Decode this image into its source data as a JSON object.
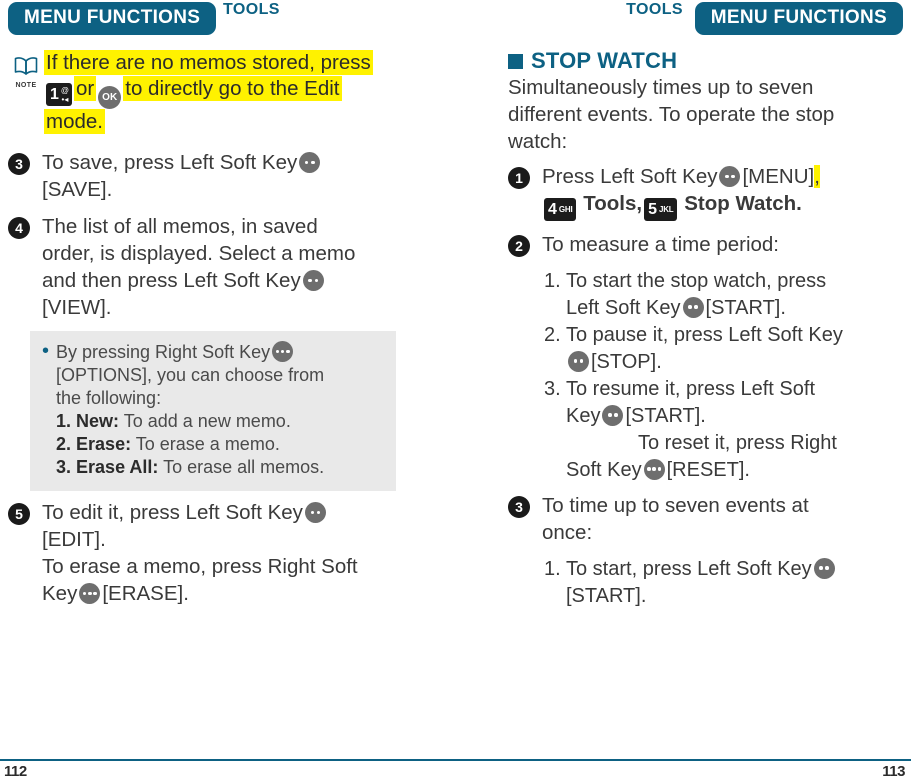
{
  "header": {
    "left_badge": "MENU FUNCTIONS",
    "left_sub": "TOOLS",
    "right_badge": "MENU FUNCTIONS",
    "right_sub": "TOOLS",
    "badge_color": "#0d6183"
  },
  "left_page": {
    "note": {
      "icon_label": "NOTE",
      "line1": "If there are no memos stored, press",
      "line2_or": "or",
      "line2_tail": "to directly go to the Edit",
      "line3": "mode.",
      "key1": {
        "digit": "1",
        "sym_top": "@",
        "sym_bottom": "•◂"
      },
      "ok_key": "OK",
      "highlight_color": "#fff200"
    },
    "steps": [
      {
        "num": "3",
        "line1_a": "To save, press Left Soft Key",
        "line2": "[SAVE]."
      },
      {
        "num": "4",
        "line1_a": "The list of all memos, in saved",
        "line2": "order, is displayed. Select a memo",
        "line3_a": "and then press Left Soft Key",
        "line4": "[VIEW]."
      }
    ],
    "options_box": {
      "bullet_line1": "By pressing Right Soft Key",
      "bullet_line2": "[OPTIONS], you can choose from",
      "bullet_line3": "the following:",
      "items": [
        {
          "num": "1.",
          "label": "New:",
          "desc": "To add a new memo."
        },
        {
          "num": "2.",
          "label": "Erase:",
          "desc": "To erase a memo."
        },
        {
          "num": "3.",
          "label": "Erase All:",
          "desc": "To erase all memos."
        }
      ]
    },
    "step5": {
      "num": "5",
      "line1_a": "To edit it, press Left Soft Key",
      "line2": "[EDIT].",
      "line3": "To erase a memo, press Right Soft",
      "line4_a": "Key",
      "line4_b": "[ERASE]."
    },
    "page_number": "112"
  },
  "right_page": {
    "section": {
      "title": "STOP WATCH",
      "intro_line1": "Simultaneously times up to seven",
      "intro_line2": "different events. To operate the stop",
      "intro_line3": "watch:"
    },
    "step1": {
      "num": "1",
      "line1_a": "Press Left Soft Key",
      "line1_b": "[MENU]",
      "line1_comma": ",",
      "line2_tools": "Tools,",
      "line2_stopwatch": "Stop Watch.",
      "key4": {
        "digit": "4",
        "letters": "GHI"
      },
      "key5": {
        "digit": "5",
        "letters": "JKL"
      }
    },
    "step2": {
      "num": "2",
      "heading": "To measure a time period:",
      "sub_items": [
        {
          "marker": "1.",
          "line1": "To start the stop watch, press",
          "line2_a": "Left Soft Key",
          "line2_b": "[START]."
        },
        {
          "marker": "2.",
          "line1": "To pause it, press Left Soft Key",
          "line2_b": "[STOP]."
        },
        {
          "marker": "3.",
          "line1": "To resume it, press Left Soft",
          "line2_a": "Key",
          "line2_b": "[START].",
          "line3": "To reset it, press Right",
          "line4_a": "Soft Key",
          "line4_b": "[RESET]."
        }
      ]
    },
    "step3": {
      "num": "3",
      "line1": "To time up to seven events at",
      "line2": "once:",
      "sub_items": [
        {
          "marker": "1.",
          "line1_a": "To start, press Left Soft Key",
          "line2": "[START]."
        }
      ]
    },
    "page_number": "113"
  }
}
